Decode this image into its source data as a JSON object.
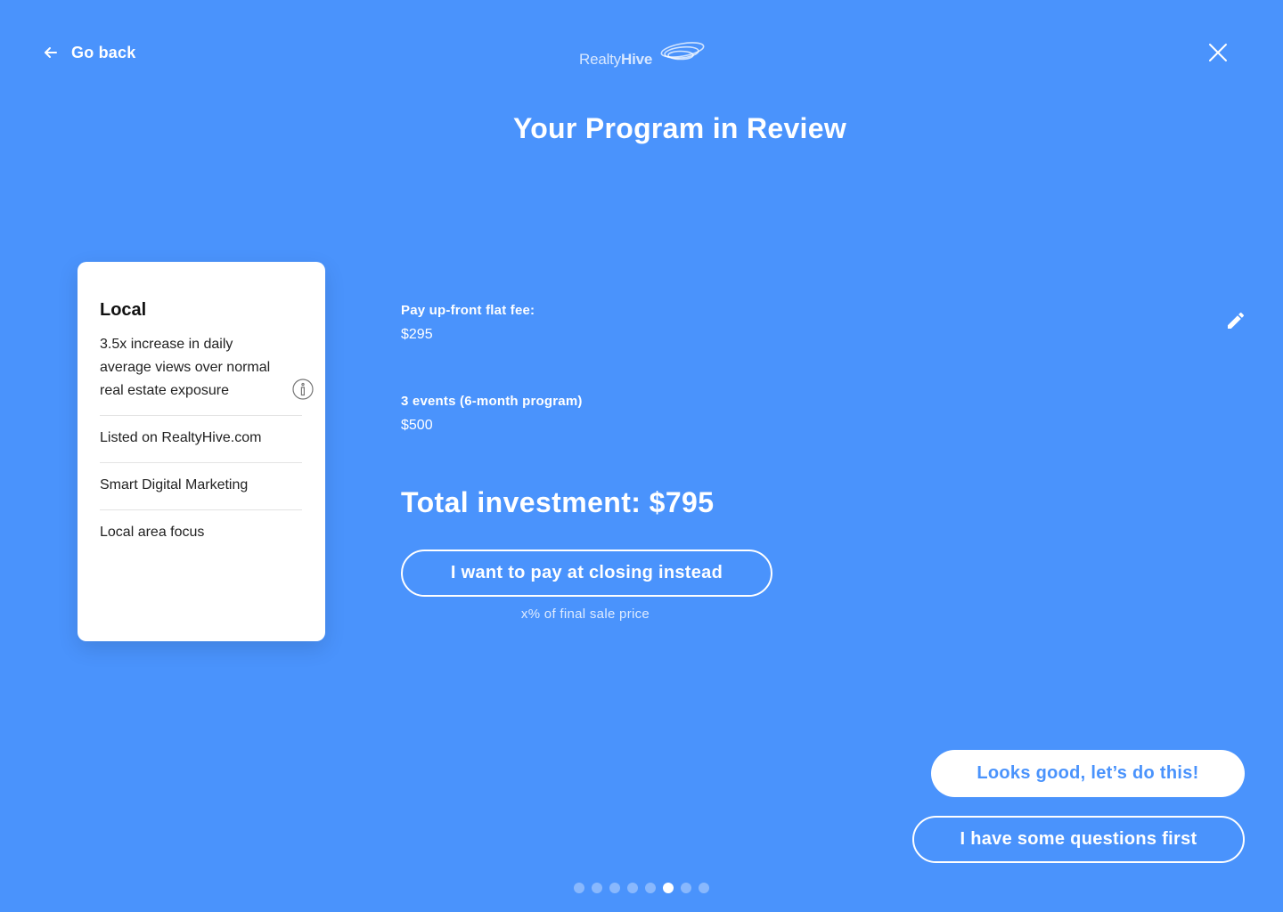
{
  "header": {
    "back_label": "Go back",
    "logo_text_light": "Realty",
    "logo_text_bold": "Hive",
    "title": "Your Program in Review"
  },
  "card": {
    "title": "Local",
    "features": [
      "3.5x increase in daily average views over normal real estate exposure",
      "Listed on RealtyHive.com",
      "Smart Digital Marketing",
      "Local area focus"
    ]
  },
  "fees": [
    {
      "label": "Pay up-front flat fee:",
      "value": "$295"
    },
    {
      "label": "3 events (6-month program)",
      "value": "$500"
    }
  ],
  "total": "Total investment: $795",
  "pay_closing": {
    "label": "I want to pay at closing instead",
    "note": "x% of final sale price"
  },
  "actions": {
    "confirm_label": "Looks good, let’s do this!",
    "questions_label": "I have some questions first"
  },
  "pagination": {
    "total": 8,
    "active": 6
  },
  "colors": {
    "background": "#4a93fc",
    "surface": "#ffffff",
    "text_dark": "#111111"
  },
  "icons": [
    "arrow-left-icon",
    "close-icon",
    "info-icon",
    "pencil-icon"
  ]
}
